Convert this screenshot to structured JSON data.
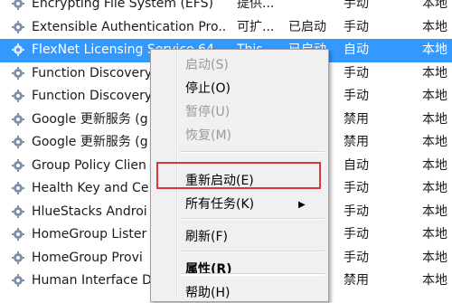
{
  "services": [
    {
      "name": "Encrypting File System (EFS)",
      "desc": "提供...",
      "status": "",
      "startup": "手动",
      "logon": "本地"
    },
    {
      "name": "Extensible Authentication Pro...",
      "desc": "可扩...",
      "status": "已启动",
      "startup": "手动",
      "logon": "本地"
    },
    {
      "name": "FlexNet Licensing Service 64",
      "desc": "This ...",
      "status": "已启动",
      "startup": "自动",
      "logon": "本地",
      "selected": true
    },
    {
      "name": "Function Discovery",
      "desc": "",
      "status": "",
      "startup": "手动",
      "logon": "本地"
    },
    {
      "name": "Function Discovery",
      "desc": "",
      "status": "",
      "startup": "手动",
      "logon": "本地"
    },
    {
      "name": "Google 更新服务 (g",
      "desc": "",
      "status": "",
      "startup": "禁用",
      "logon": "本地"
    },
    {
      "name": "Google 更新服务 (g",
      "desc": "",
      "status": "",
      "startup": "禁用",
      "logon": "本地"
    },
    {
      "name": "Group Policy Clien",
      "desc": "",
      "status": "",
      "startup": "自动",
      "logon": "本地"
    },
    {
      "name": "Health Key and Ce",
      "desc": "",
      "status": "",
      "startup": "手动",
      "logon": "本地"
    },
    {
      "name": "HlueStacks Androi",
      "desc": "",
      "status": "",
      "startup": "手动",
      "logon": "本地"
    },
    {
      "name": "HomeGroup Lister",
      "desc": "",
      "status": "",
      "startup": "手动",
      "logon": "本地"
    },
    {
      "name": "HomeGroup Provi",
      "desc": "",
      "status": "",
      "startup": "手动",
      "logon": "本地"
    },
    {
      "name": "Human Interface D",
      "desc": "",
      "status": "",
      "startup": "禁用",
      "logon": "本地"
    }
  ],
  "context_menu": {
    "start": "启动(S)",
    "stop": "停止(O)",
    "pause": "暂停(U)",
    "resume": "恢复(M)",
    "restart": "重新启动(E)",
    "all_tasks": "所有任务(K)",
    "refresh": "刷新(F)",
    "properties": "属性(R)",
    "help": "帮助(H)"
  },
  "colors": {
    "selection": "#3399ff",
    "highlight_border": "#d9383a"
  }
}
